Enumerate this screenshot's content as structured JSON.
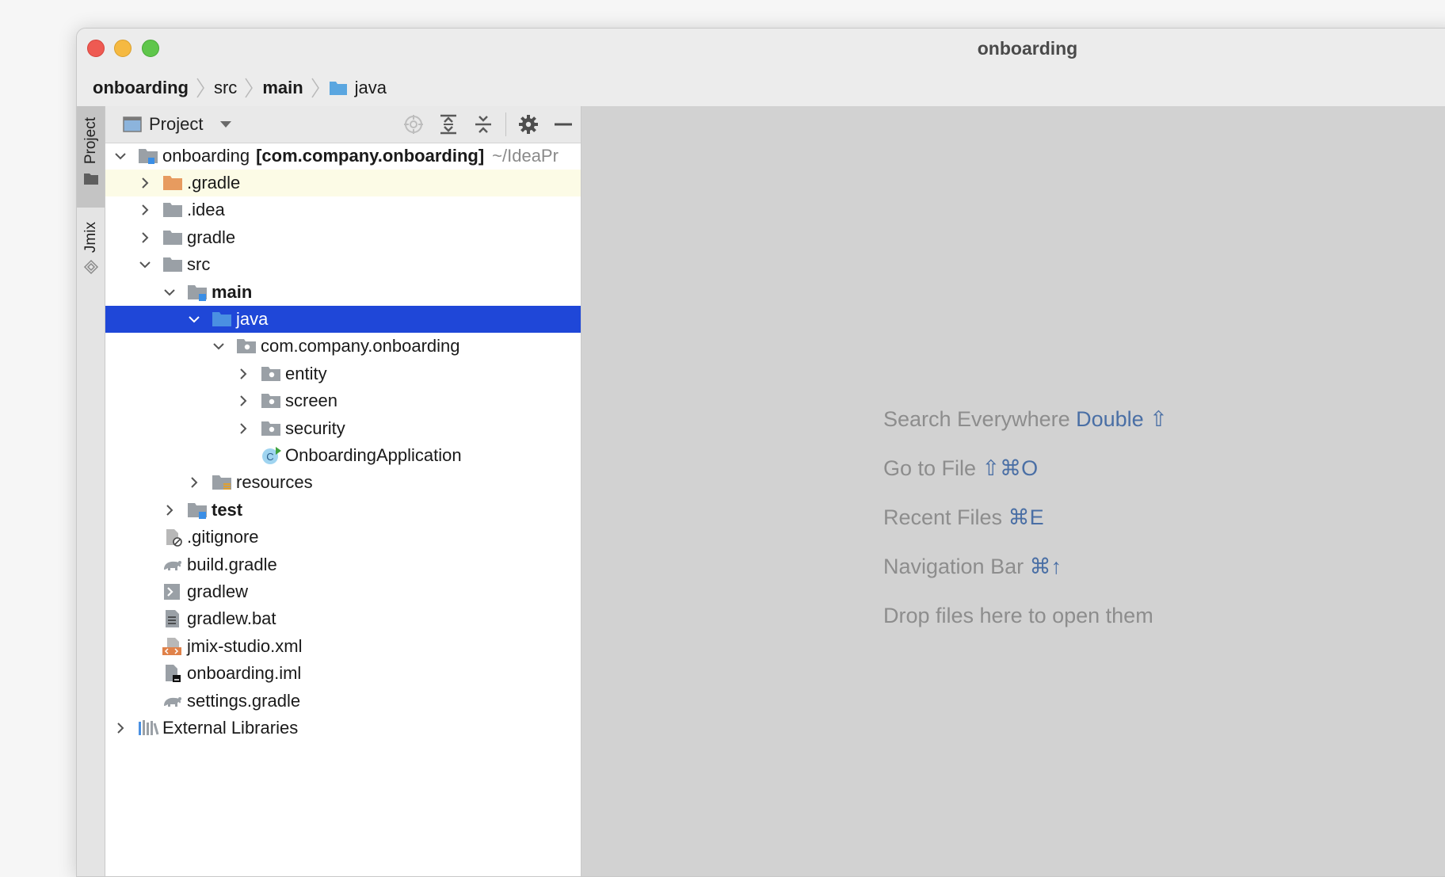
{
  "window": {
    "title": "onboarding"
  },
  "breadcrumb": [
    "onboarding",
    "src",
    "main",
    "java"
  ],
  "tool_windows": {
    "project_tab": "Project",
    "jmix_tab": "Jmix"
  },
  "project_panel": {
    "title": "Project",
    "tools": [
      "locate-icon",
      "expand-all-icon",
      "collapse-all-icon",
      "gear-icon",
      "minimize-icon"
    ]
  },
  "tree": [
    {
      "label": "onboarding",
      "module": "[com.company.onboarding]",
      "path": "~/IdeaPr",
      "expanded": true
    },
    {
      "label": ".gradle",
      "expanded": false
    },
    {
      "label": ".idea",
      "expanded": false
    },
    {
      "label": "gradle",
      "expanded": false
    },
    {
      "label": "src",
      "expanded": true
    },
    {
      "label": "main",
      "expanded": true
    },
    {
      "label": "java",
      "expanded": true,
      "selected": true
    },
    {
      "label": "com.company.onboarding",
      "expanded": true
    },
    {
      "label": "entity",
      "expanded": false
    },
    {
      "label": "screen",
      "expanded": false
    },
    {
      "label": "security",
      "expanded": false
    },
    {
      "label": "OnboardingApplication"
    },
    {
      "label": "resources",
      "expanded": false
    },
    {
      "label": "test",
      "expanded": false
    },
    {
      "label": ".gitignore"
    },
    {
      "label": "build.gradle"
    },
    {
      "label": "gradlew"
    },
    {
      "label": "gradlew.bat"
    },
    {
      "label": "jmix-studio.xml"
    },
    {
      "label": "onboarding.iml"
    },
    {
      "label": "settings.gradle"
    },
    {
      "label": "External Libraries",
      "expanded": false
    }
  ],
  "editor_hints": [
    {
      "text": "Search Everywhere",
      "key": "Double ⇧"
    },
    {
      "text": "Go to File",
      "key": "⇧⌘O"
    },
    {
      "text": "Recent Files",
      "key": "⌘E"
    },
    {
      "text": "Navigation Bar",
      "key": "⌘↑"
    },
    {
      "text": "Drop files here to open them",
      "key": ""
    }
  ]
}
